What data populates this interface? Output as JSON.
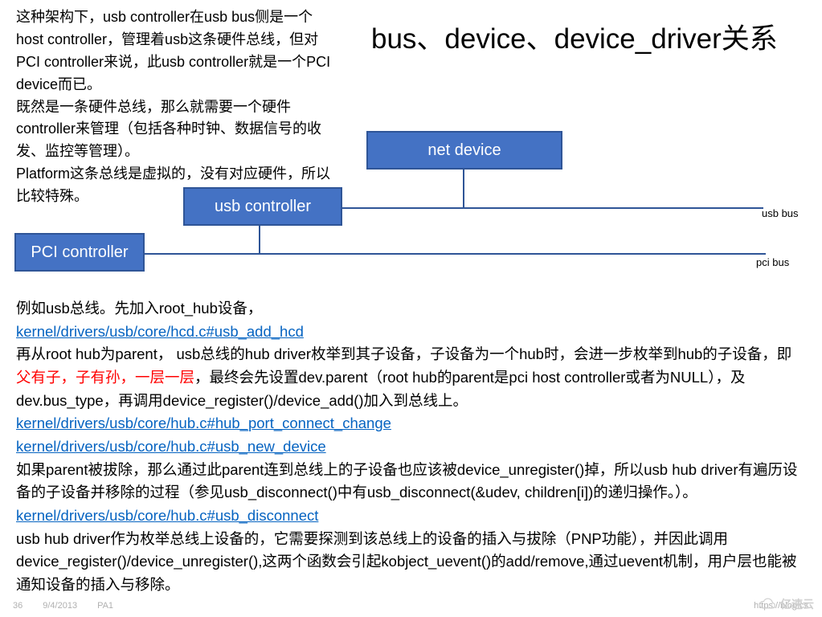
{
  "title": "bus、device、device_driver关系",
  "intro": {
    "p1": "这种架构下，usb controller在usb bus侧是一个host controller，管理着usb这条硬件总线，但对PCI controller来说，此usb controller就是一个PCI device而已。",
    "p2": "既然是一条硬件总线，那么就需要一个硬件controller来管理（包括各种时钟、数据信号的收发、监控等管理）。",
    "p3": "Platform这条总线是虚拟的，没有对应硬件，所以比较特殊。"
  },
  "boxes": {
    "net": "net device",
    "usb": "usb controller",
    "pci": "PCI controller"
  },
  "bus_labels": {
    "usb": "usb  bus",
    "pci": "pci bus"
  },
  "body": {
    "p1": "例如usb总线。先加入root_hub设备，",
    "link1": "kernel/drivers/usb/core/hcd.c#usb_add_hcd",
    "p2a": "再从root hub为parent， usb总线的hub driver枚举到其子设备，子设备为一个hub时，会进一步枚举到hub的子设备，即",
    "p2red": "父有子，子有孙，一层一层",
    "p2b": "，最终会先设置dev.parent（root hub的parent是pci host controller或者为NULL），及dev.bus_type，再调用device_register()/device_add()加入到总线上。",
    "link2": "kernel/drivers/usb/core/hub.c#hub_port_connect_change",
    "link3": "kernel/drivers/usb/core/hub.c#usb_new_device",
    "p3": "如果parent被拔除，那么通过此parent连到总线上的子设备也应该被device_unregister()掉，所以usb hub driver有遍历设备的子设备并移除的过程（参见usb_disconnect()中有usb_disconnect(&udev, children[i])的递归操作。）。",
    "link4": "kernel/drivers/usb/core/hub.c#usb_disconnect",
    "p4": "usb hub driver作为枚举总线上设备的，它需要探测到该总线上的设备的插入与拔除（PNP功能），并因此调用device_register()/device_unregister(),这两个函数会引起kobject_uevent()的add/remove,通过uevent机制，用户层也能被通知设备的插入与移除。"
  },
  "footer": {
    "page": "36",
    "date": "9/4/2013",
    "author": "PA1",
    "blog": "https://blog.cs"
  },
  "watermark": "亿速云"
}
